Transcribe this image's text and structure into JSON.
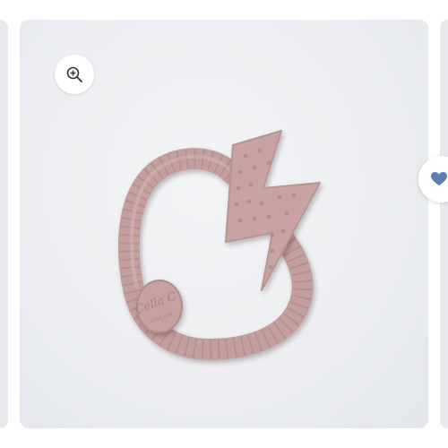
{
  "gallery": {
    "zoom_button": {
      "icon": "zoom-in-icon"
    },
    "wishlist_button": {
      "icon": "heart-icon",
      "color": "#5b7fb0"
    },
    "product_image": {
      "subject": "teether",
      "brand_text": "Cella C",
      "brand_subtext": "LITTLE ONE",
      "color": "#c4a09e"
    }
  }
}
